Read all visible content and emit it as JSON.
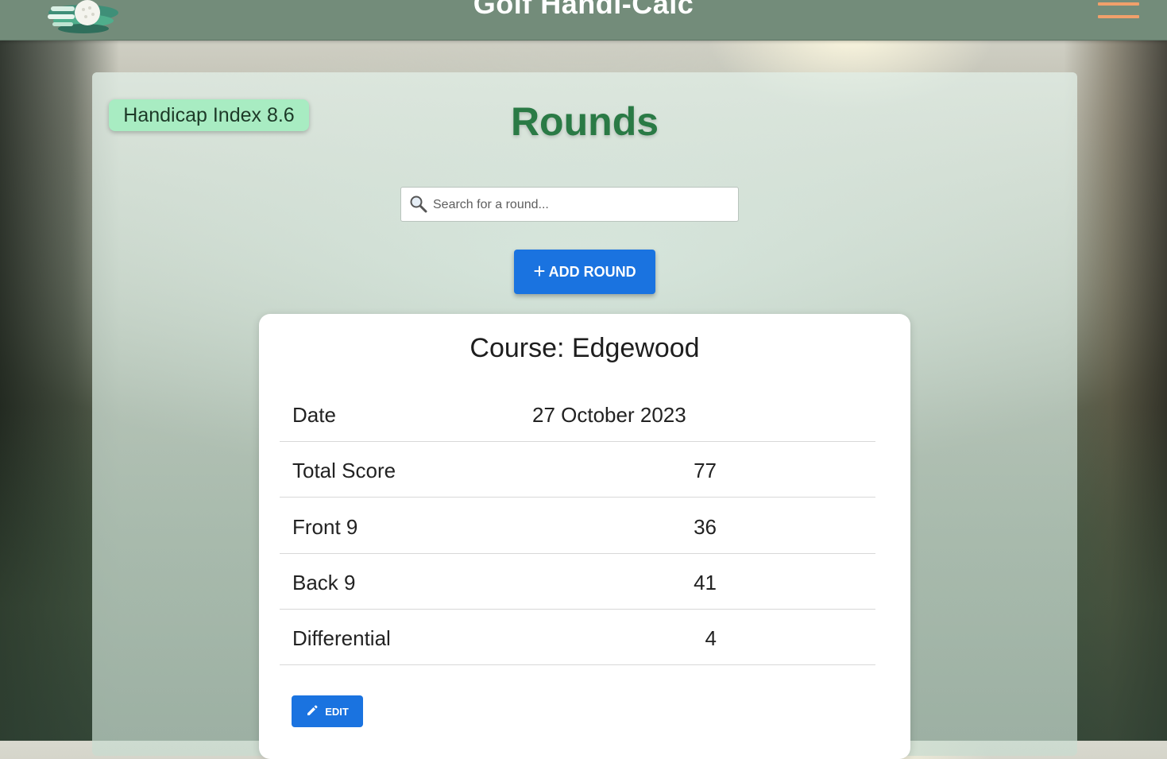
{
  "header": {
    "title": "Golf Handi-Calc",
    "logo_icon": "golf-ball-logo-icon",
    "menu_icon": "hamburger-menu-icon"
  },
  "handicap": {
    "label": "Handicap Index 8.6"
  },
  "page": {
    "title": "Rounds"
  },
  "search": {
    "placeholder": "Search for a round...",
    "value": "",
    "icon": "magnifier-icon"
  },
  "actions": {
    "add_round_icon": "+",
    "add_round_label": "ADD ROUND"
  },
  "round": {
    "course": "Course: Edgewood",
    "rows": [
      {
        "label": "Date",
        "value": "27 October 2023"
      },
      {
        "label": "Total Score",
        "value": "77"
      },
      {
        "label": "Front 9",
        "value": "36"
      },
      {
        "label": "Back 9",
        "value": "41"
      },
      {
        "label": "Differential",
        "value": "4"
      }
    ],
    "edit_label": "EDIT",
    "edit_icon": "pencil-icon"
  },
  "colors": {
    "header": "#738c7a",
    "accent_menu": "#f0a06b",
    "badge": "#a8ecc2",
    "title_green": "#2a7a45",
    "primary_button": "#1a73e0"
  }
}
